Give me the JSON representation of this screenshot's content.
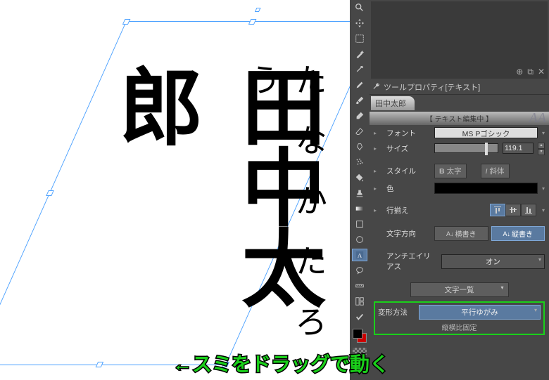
{
  "canvas": {
    "main_text": "田中太郎",
    "ruby_text": "たなかたろう"
  },
  "tools": [
    {
      "name": "magnifier-icon",
      "glyph": "search"
    },
    {
      "name": "move-icon",
      "glyph": "move"
    },
    {
      "name": "marquee-icon",
      "glyph": "marquee"
    },
    {
      "name": "wand-icon",
      "glyph": "wand"
    },
    {
      "name": "eyedropper-icon",
      "glyph": "eyedropper"
    },
    {
      "name": "pen-icon",
      "glyph": "pen"
    },
    {
      "name": "brush-icon",
      "glyph": "brush"
    },
    {
      "name": "marker-icon",
      "glyph": "marker"
    },
    {
      "name": "eraser-icon",
      "glyph": "eraser"
    },
    {
      "name": "blend-icon",
      "glyph": "blend"
    },
    {
      "name": "spray-icon",
      "glyph": "spray"
    },
    {
      "name": "fill-icon",
      "glyph": "fill"
    },
    {
      "name": "stamp-icon",
      "glyph": "stamp"
    },
    {
      "name": "gradient-icon",
      "glyph": "gradient"
    },
    {
      "name": "shape-outline-icon",
      "glyph": "shape-outline"
    },
    {
      "name": "shape-icon",
      "glyph": "shape"
    },
    {
      "name": "text-icon",
      "glyph": "text",
      "selected": true
    },
    {
      "name": "balloon-icon",
      "glyph": "balloon"
    },
    {
      "name": "ruler-icon",
      "glyph": "ruler"
    },
    {
      "name": "panel-icon",
      "glyph": "panel"
    },
    {
      "name": "correction-icon",
      "glyph": "correction"
    }
  ],
  "panel": {
    "preview_icons": [
      "⊕",
      "⧉",
      "✕"
    ],
    "title": "ツールプロパティ[テキスト]",
    "tab_label": "田中太郎",
    "editing_label": "【 テキスト編集中 】",
    "font_label": "フォント",
    "font_value": "MS Pゴシック",
    "size_label": "サイズ",
    "size_value": "119.1",
    "style_label": "スタイル",
    "bold_label": "太字",
    "italic_label": "斜体",
    "color_label": "色",
    "align_label": "行揃え",
    "direction_label": "文字方向",
    "horizontal_label": "横書き",
    "vertical_label": "縦書き",
    "antialias_label": "アンチエイリアス",
    "antialias_value": "オン",
    "char_list_label": "文字一覧",
    "transform_label": "変形方法",
    "transform_value": "平行ゆがみ",
    "ratio_lock_label": "縦横比固定"
  },
  "annotation": {
    "arrow": "←",
    "text": "スミをドラッグで動く"
  }
}
